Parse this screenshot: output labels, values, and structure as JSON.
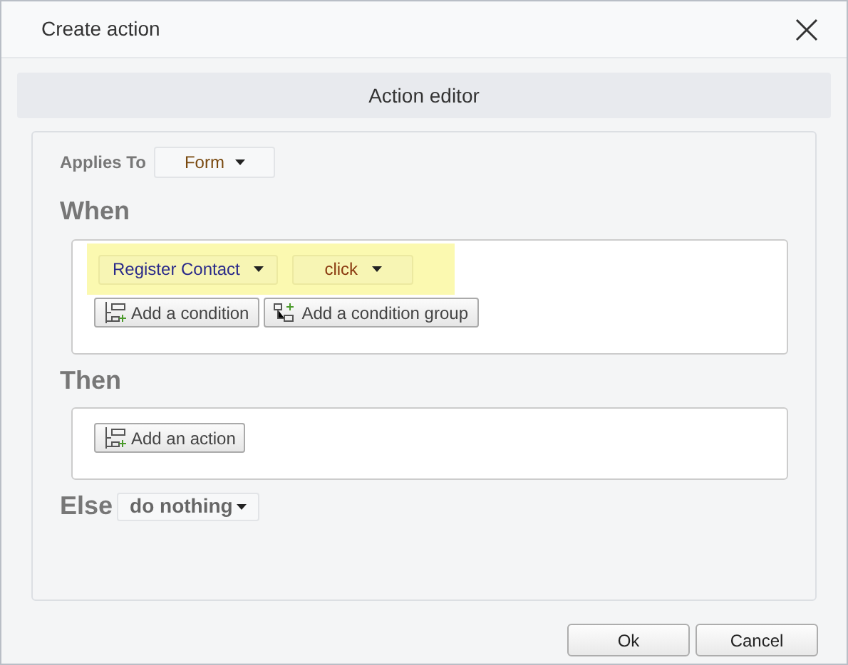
{
  "window": {
    "title": "Create action"
  },
  "header": "Action editor",
  "applies_to": {
    "label": "Applies To",
    "value": "Form"
  },
  "when": {
    "label": "When",
    "trigger": [
      {
        "value": "Register Contact",
        "kind": "element"
      },
      {
        "value": "click",
        "kind": "event"
      }
    ],
    "buttons": [
      {
        "label": "Add a condition",
        "kind": "condition"
      },
      {
        "label": "Add a condition group",
        "kind": "group"
      }
    ]
  },
  "then": {
    "label": "Then",
    "buttons": [
      {
        "label": "Add an action",
        "kind": "condition"
      }
    ]
  },
  "else": {
    "label": "Else",
    "value": "do nothing"
  },
  "footer_buttons": [
    "Ok",
    "Cancel"
  ]
}
